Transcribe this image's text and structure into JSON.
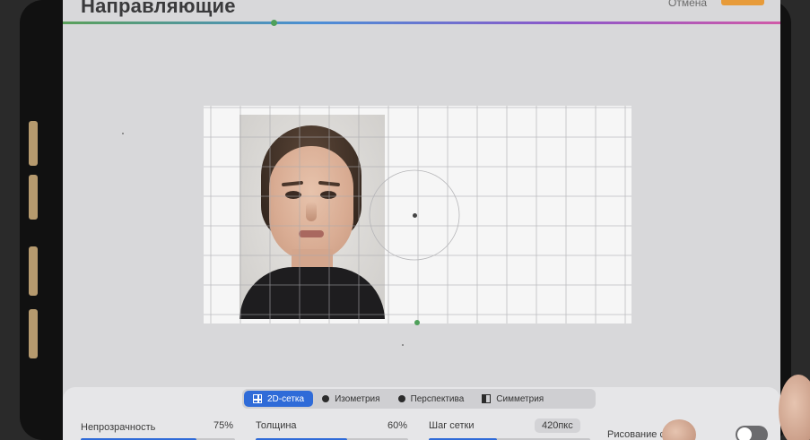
{
  "header": {
    "title": "Направляющие",
    "cancel_label": "Отмена"
  },
  "tabs": [
    {
      "label": "2D-сетка",
      "icon": "grid-icon",
      "active": true
    },
    {
      "label": "Изометрия",
      "icon": "isometric-icon",
      "active": false
    },
    {
      "label": "Перспектива",
      "icon": "perspective-icon",
      "active": false
    },
    {
      "label": "Симметрия",
      "icon": "symmetry-icon",
      "active": false
    }
  ],
  "controls": {
    "opacity": {
      "label": "Непрозрачность",
      "value": "75%",
      "level": 0.75
    },
    "thickness": {
      "label": "Толщина",
      "value": "60%",
      "level": 0.6
    },
    "grid_step": {
      "label": "Шаг сетки",
      "value": "420пкс",
      "level": 0.42
    },
    "assisted_drawing": {
      "label": "Рисование с приі",
      "enabled": false
    }
  },
  "colors": {
    "accent": "#2f6bd8",
    "done_button": "#e79b3a",
    "guide_handle": "#4fa05a"
  }
}
